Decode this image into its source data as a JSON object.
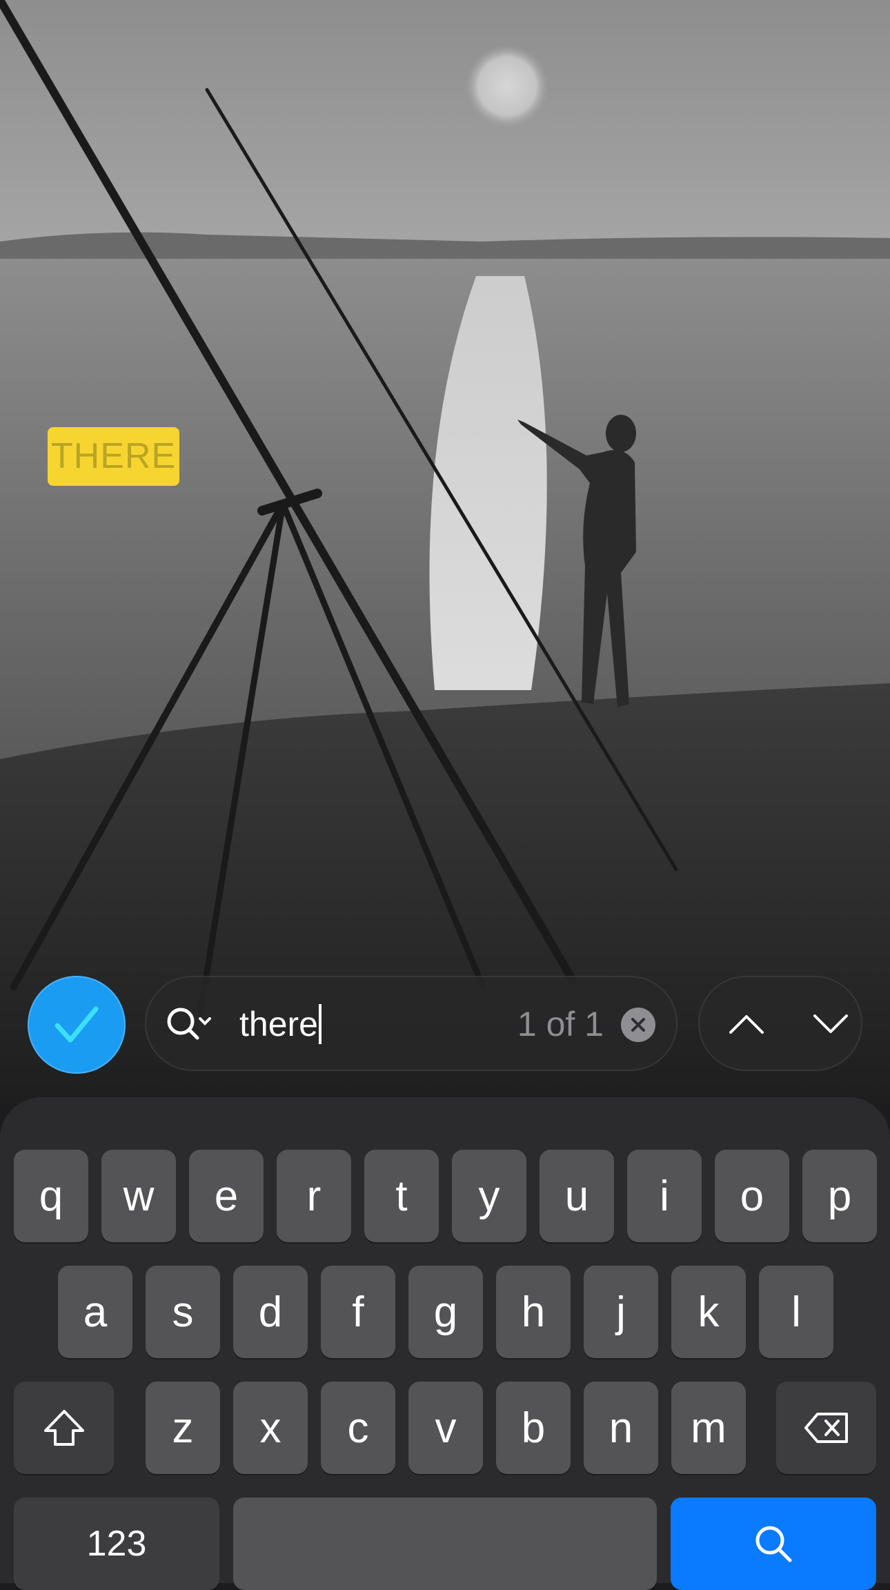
{
  "photo": {
    "description_icon": "beach-fishing-photo"
  },
  "highlight": {
    "text": "THERE"
  },
  "find_bar": {
    "query": "there",
    "match_count": "1 of 1",
    "accent_color": "#1a9cf2",
    "icons": {
      "done": "checkmark-icon",
      "search": "search-options-icon",
      "clear": "clear-icon",
      "previous": "chevron-up-icon",
      "next": "chevron-down-icon"
    }
  },
  "keyboard": {
    "row1": [
      "q",
      "w",
      "e",
      "r",
      "t",
      "y",
      "u",
      "i",
      "o",
      "p"
    ],
    "row2": [
      "a",
      "s",
      "d",
      "f",
      "g",
      "h",
      "j",
      "k",
      "l"
    ],
    "row3": [
      "z",
      "x",
      "c",
      "v",
      "b",
      "n",
      "m"
    ],
    "numbers_label": "123",
    "search_key_color": "#0a7aff",
    "icons": {
      "shift": "shift-icon",
      "delete": "delete-icon",
      "search": "search-icon"
    }
  }
}
